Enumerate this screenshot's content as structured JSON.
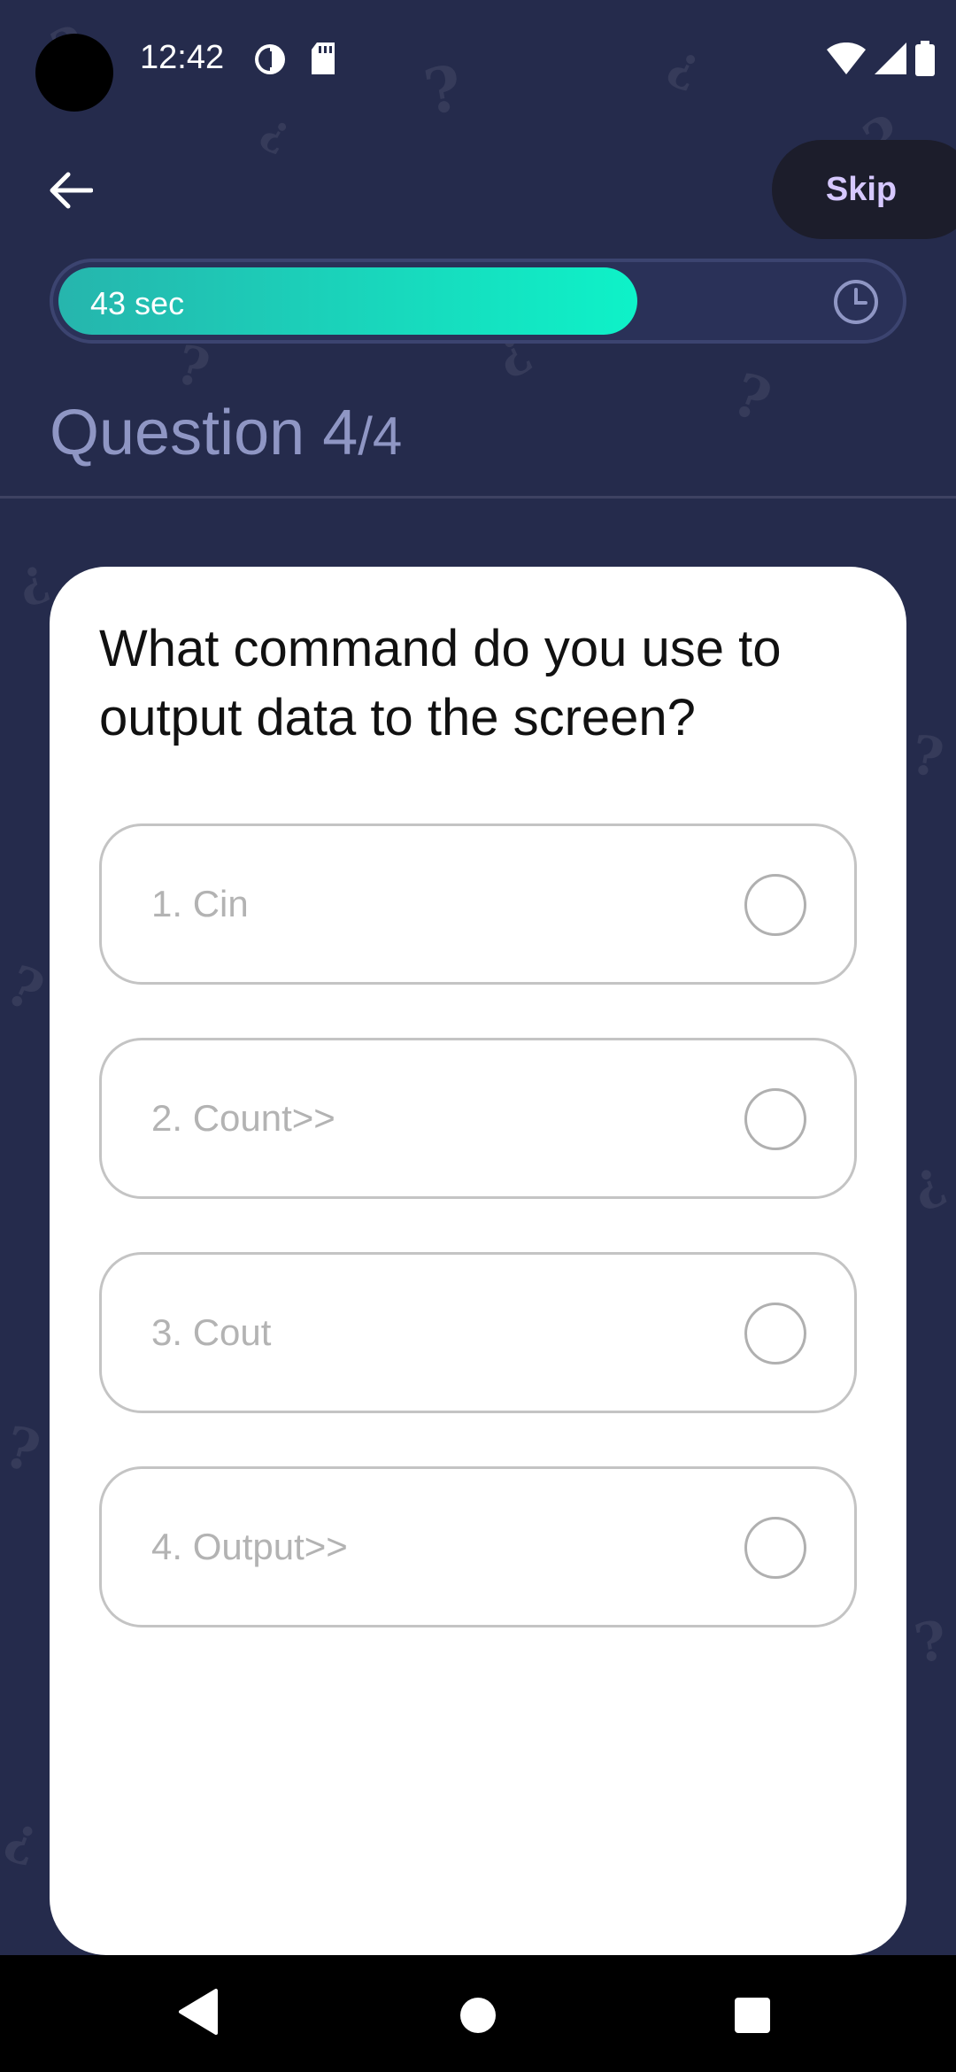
{
  "status": {
    "time": "12:42"
  },
  "toolbar": {
    "skip_label": "Skip"
  },
  "timer": {
    "label": "43 sec",
    "remaining_fraction": 0.69
  },
  "question": {
    "current": "4",
    "total": "4",
    "prefix": "Question",
    "text": "What command do you use to output data to the screen?",
    "options": [
      {
        "label": "1. Cin"
      },
      {
        "label": "2. Count>>"
      },
      {
        "label": "3. Cout"
      },
      {
        "label": "4. Output>>"
      }
    ]
  },
  "colors": {
    "background": "#252b4c",
    "timer_start": "#26b5ad",
    "timer_end": "#0ef2c8",
    "skip_text": "#d6c8ff"
  }
}
